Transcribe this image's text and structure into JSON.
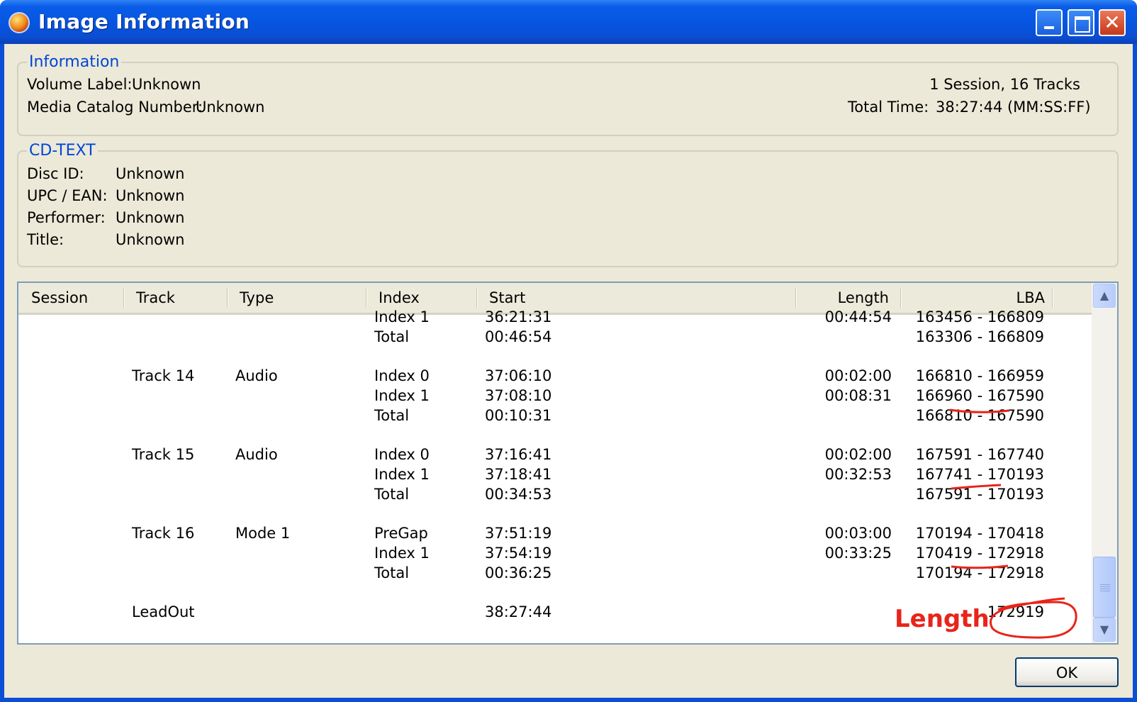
{
  "window": {
    "title": "Image Information",
    "minimize": "",
    "maximize": "",
    "close": "✕"
  },
  "info": {
    "legend": "Information",
    "volume_label_label": "Volume Label:",
    "volume_label_value": "Unknown",
    "mcn_label": "Media Catalog Number:",
    "mcn_value": "Unknown",
    "sessions_tracks": "1 Session, 16 Tracks",
    "total_time_label": "Total Time:",
    "total_time_value": "38:27:44 (MM:SS:FF)"
  },
  "cdtext": {
    "legend": "CD-TEXT",
    "rows": [
      {
        "label": "Disc ID:",
        "value": "Unknown"
      },
      {
        "label": "UPC / EAN:",
        "value": "Unknown"
      },
      {
        "label": "Performer:",
        "value": "Unknown"
      },
      {
        "label": "Title:",
        "value": "Unknown"
      }
    ]
  },
  "table": {
    "headers": [
      "Session",
      "Track",
      "Type",
      "Index",
      "Start",
      "Length",
      "LBA"
    ],
    "rows": [
      {
        "track": "",
        "type": "",
        "index": "Index 1",
        "start": "36:21:31",
        "length": "00:44:54",
        "lba": "163456 - 166809"
      },
      {
        "track": "",
        "type": "",
        "index": "Total",
        "start": "00:46:54",
        "length": "",
        "lba": "163306 - 166809"
      },
      {
        "track": "Track 14",
        "type": "Audio",
        "index": "Index 0",
        "start": "37:06:10",
        "length": "00:02:00",
        "lba": "166810 - 166959"
      },
      {
        "track": "",
        "type": "",
        "index": "Index 1",
        "start": "37:08:10",
        "length": "00:08:31",
        "lba": "166960 - 167590"
      },
      {
        "track": "",
        "type": "",
        "index": "Total",
        "start": "00:10:31",
        "length": "",
        "lba": "166810 - 167590"
      },
      {
        "track": "Track 15",
        "type": "Audio",
        "index": "Index 0",
        "start": "37:16:41",
        "length": "00:02:00",
        "lba": "167591 - 167740"
      },
      {
        "track": "",
        "type": "",
        "index": "Index 1",
        "start": "37:18:41",
        "length": "00:32:53",
        "lba": "167741 - 170193"
      },
      {
        "track": "",
        "type": "",
        "index": "Total",
        "start": "00:34:53",
        "length": "",
        "lba": "167591 - 170193"
      },
      {
        "track": "Track 16",
        "type": "Mode 1",
        "index": "PreGap",
        "start": "37:51:19",
        "length": "00:03:00",
        "lba": "170194 - 170418"
      },
      {
        "track": "",
        "type": "",
        "index": "Index 1",
        "start": "37:54:19",
        "length": "00:33:25",
        "lba": "170419 - 172918"
      },
      {
        "track": "",
        "type": "",
        "index": "Total",
        "start": "00:36:25",
        "length": "",
        "lba": "170194 - 172918"
      },
      {
        "track": "LeadOut",
        "type": "",
        "index": "",
        "start": "38:27:44",
        "length": "",
        "lba": "172919"
      }
    ]
  },
  "annotation": {
    "label": "Length",
    "color": "#E8241A"
  },
  "scrollbar": {
    "up_icon": "▲",
    "down_icon": "▼"
  },
  "buttons": {
    "ok": "OK"
  },
  "colors": {
    "titlebar": "#0555E0",
    "legend": "#0046D5",
    "face": "#ECE9D8"
  }
}
